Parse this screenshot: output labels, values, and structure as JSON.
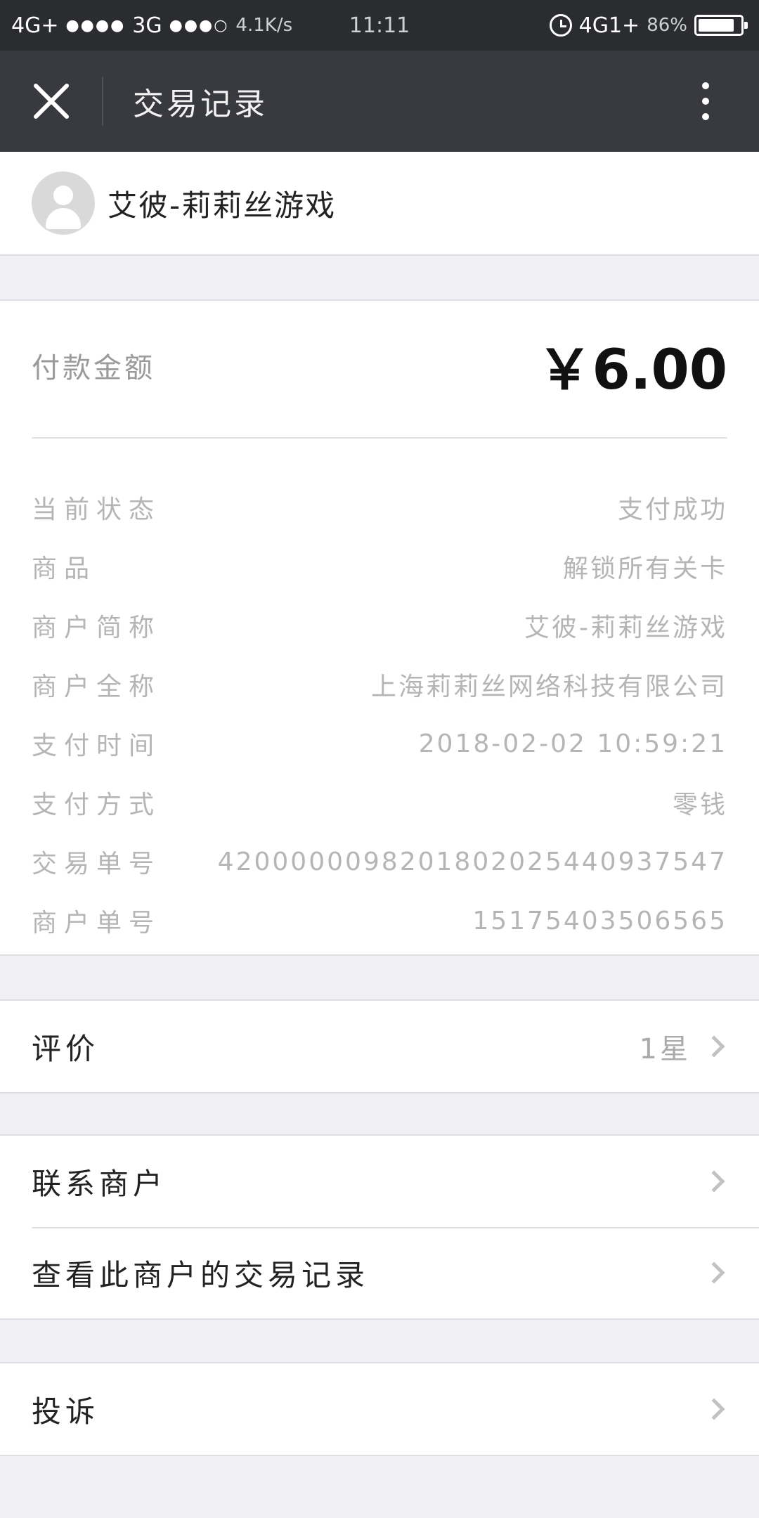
{
  "status_bar": {
    "network_left": "4G+",
    "signal_left": "●●●●",
    "network_mid": "3G",
    "signal_mid": "●●●○",
    "speed": "4.1K/s",
    "time": "11:11",
    "network_right": "4G1+",
    "battery": "86%",
    "battery_level": 0.86
  },
  "header": {
    "title": "交易记录",
    "close_icon": "close-icon",
    "more_icon": "more-vertical-icon"
  },
  "merchant": {
    "name": "艾彼-莉莉丝游戏"
  },
  "payment": {
    "amount_label": "付款金额",
    "amount": "￥6.00"
  },
  "details": [
    {
      "label": "当前状态",
      "value": "支付成功"
    },
    {
      "label": "商品",
      "value": "解锁所有关卡"
    },
    {
      "label": "商户简称",
      "value": "艾彼-莉莉丝游戏"
    },
    {
      "label": "商户全称",
      "value": "上海莉莉丝网络科技有限公司"
    },
    {
      "label": "支付时间",
      "value": "2018-02-02 10:59:21"
    },
    {
      "label": "支付方式",
      "value": "零钱"
    },
    {
      "label": "交易单号",
      "value": "4200000098201802025440937547"
    },
    {
      "label": "商户单号",
      "value": "15175403506565"
    }
  ],
  "rating": {
    "label": "评价",
    "value": "1星"
  },
  "contact": {
    "label": "联系商户"
  },
  "history": {
    "label": "查看此商户的交易记录"
  },
  "complaint": {
    "label": "投诉"
  },
  "colors": {
    "status_bar": "#2b2c30",
    "header": "#393a3f",
    "background": "#efeff4"
  }
}
